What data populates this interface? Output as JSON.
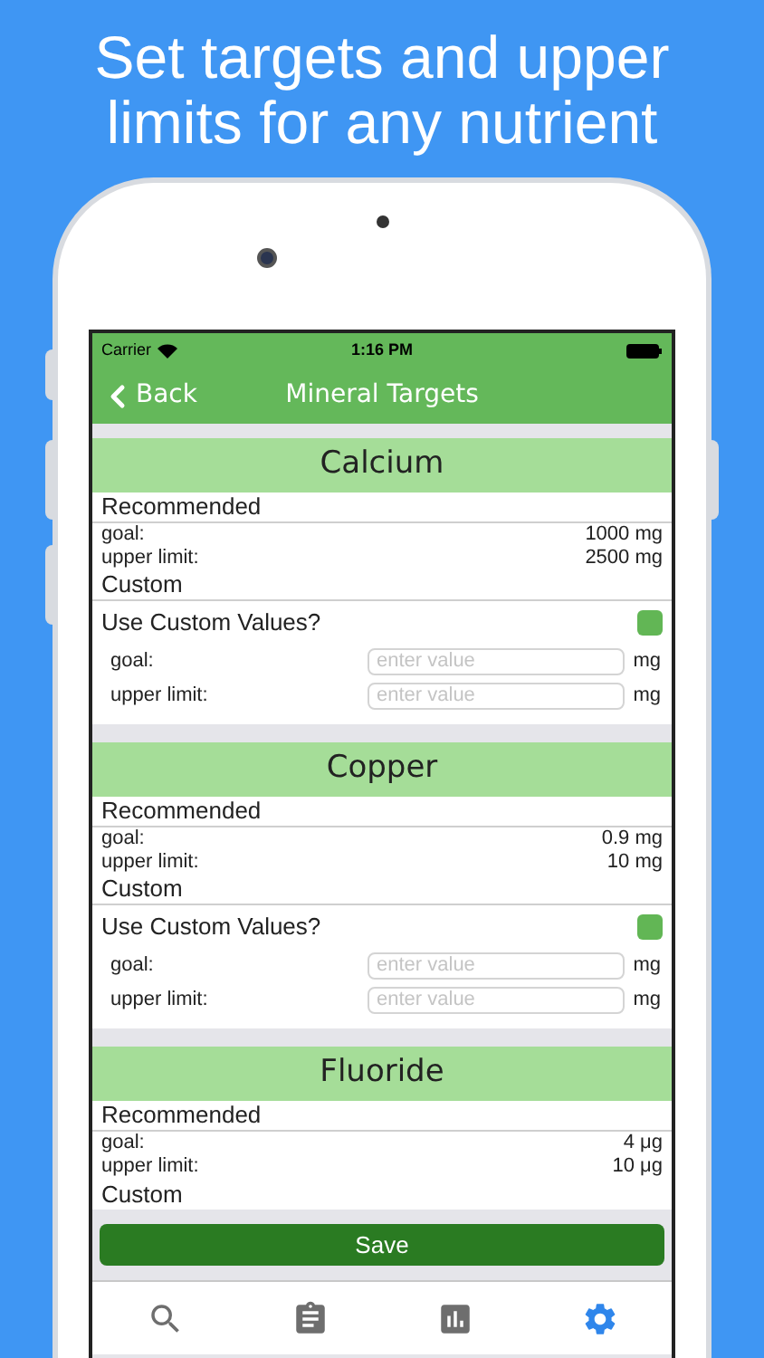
{
  "headline": [
    "Set targets and upper",
    "limits for any nutrient"
  ],
  "status_bar": {
    "carrier": "Carrier",
    "time": "1:16 PM"
  },
  "nav_bar": {
    "back": "Back",
    "title": "Mineral Targets"
  },
  "sections": [
    {
      "name": "Calcium",
      "recommended_label": "Recommended",
      "rows": [
        {
          "label": "goal:",
          "value": "1000 mg"
        },
        {
          "label": "upper limit:",
          "value": "2500 mg"
        }
      ],
      "custom_label": "Custom",
      "custom": {
        "label": "Use Custom Values?",
        "checked": true,
        "fields": [
          {
            "label": "goal:",
            "placeholder": "enter value",
            "unit": "mg"
          },
          {
            "label": "upper limit:",
            "placeholder": "enter value",
            "unit": "mg"
          }
        ]
      }
    },
    {
      "name": "Copper",
      "recommended_label": "Recommended",
      "rows": [
        {
          "label": "goal:",
          "value": "0.9 mg"
        },
        {
          "label": "upper limit:",
          "value": "10 mg"
        }
      ],
      "custom_label": "Custom",
      "custom": {
        "label": "Use Custom Values?",
        "checked": true,
        "fields": [
          {
            "label": "goal:",
            "placeholder": "enter value",
            "unit": "mg"
          },
          {
            "label": "upper limit:",
            "placeholder": "enter value",
            "unit": "mg"
          }
        ]
      }
    },
    {
      "name": "Fluoride",
      "recommended_label": "Recommended",
      "rows": [
        {
          "label": "goal:",
          "value": "4 μg"
        },
        {
          "label": "upper limit:",
          "value": "10 μg"
        }
      ],
      "custom_label": "Custom"
    }
  ],
  "save_button": "Save",
  "tab_bar": [
    {
      "kind": "search",
      "selected": false
    },
    {
      "kind": "log",
      "selected": false
    },
    {
      "kind": "charts",
      "selected": false
    },
    {
      "kind": "settings",
      "selected": true
    }
  ]
}
